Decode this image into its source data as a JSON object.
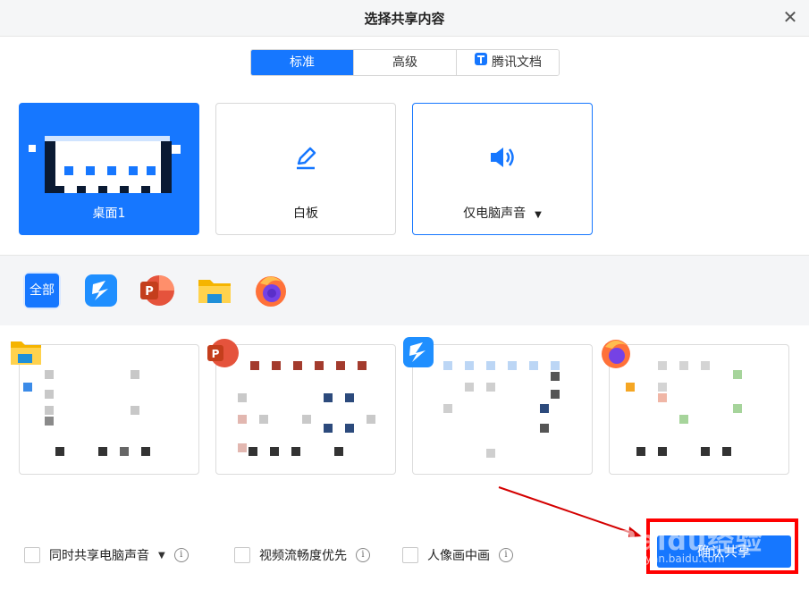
{
  "dialog": {
    "title": "选择共享内容",
    "close_glyph": "✕"
  },
  "tabs": [
    {
      "label": "标准",
      "active": true
    },
    {
      "label": "高级",
      "active": false
    },
    {
      "label": "腾讯文档",
      "active": false,
      "icon": "tencent-docs-icon"
    }
  ],
  "cards": [
    {
      "label": "桌面1",
      "selected": true
    },
    {
      "label": "白板",
      "selected": false,
      "icon": "pencil-icon"
    },
    {
      "label": "仅电脑声音",
      "selected": false,
      "icon": "speaker-icon",
      "has_dropdown": true
    }
  ],
  "apps": [
    {
      "label": "全部",
      "active": true
    },
    {
      "name": "tencent-meeting-app-icon"
    },
    {
      "name": "powerpoint-app-icon"
    },
    {
      "name": "file-explorer-app-icon"
    },
    {
      "name": "firefox-app-icon"
    }
  ],
  "options": [
    {
      "label": "同时共享电脑声音",
      "checked": false,
      "has_dropdown": true
    },
    {
      "label": "视频流畅度优先",
      "checked": false
    },
    {
      "label": "人像画中画",
      "checked": false
    }
  ],
  "confirm_label": "确认共享",
  "watermark": {
    "main": "Baidu经验",
    "sub": "jingyan.baidu.com"
  },
  "colors": {
    "accent": "#1677ff",
    "highlight": "#ff0000"
  }
}
